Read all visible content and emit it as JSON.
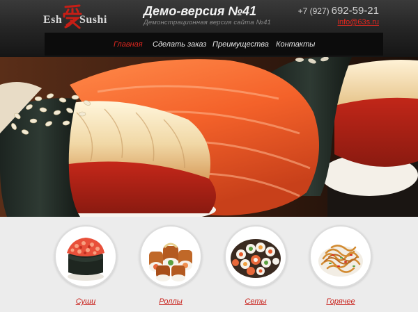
{
  "header": {
    "logo": {
      "word1": "Esh",
      "word2": "Sushi"
    },
    "title": "Демо-версия №41",
    "subtitle": "Демонстрационная версия сайта №41",
    "phone_code": "+7 (927)",
    "phone_number": "692-59-21",
    "email": "info@63s.ru"
  },
  "nav": {
    "items": [
      {
        "label": "Главная",
        "active": true
      },
      {
        "label": "Сделать заказ",
        "active": false
      },
      {
        "label": "Преимущества",
        "active": false
      },
      {
        "label": "Контакты",
        "active": false
      }
    ]
  },
  "categories": [
    {
      "label": "Суши",
      "icon": "sushi-icon"
    },
    {
      "label": "Роллы",
      "icon": "rolls-icon"
    },
    {
      "label": "Сеты",
      "icon": "sets-icon"
    },
    {
      "label": "Горячее",
      "icon": "hot-dishes-icon"
    }
  ],
  "colors": {
    "accent": "#e0271f",
    "header_bg": "#262626",
    "nav_bg": "#0c0c0c",
    "page_bg": "#ececec"
  }
}
